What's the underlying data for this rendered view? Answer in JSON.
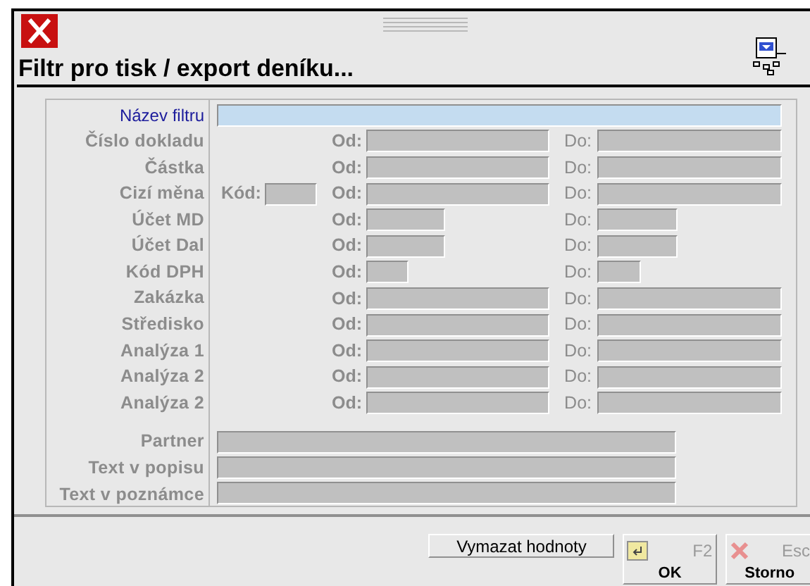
{
  "window": {
    "title": "Filtr pro tisk / export deníku..."
  },
  "name_filter": {
    "label": "Název filtru",
    "focused": true
  },
  "range_rows": [
    {
      "label": "Číslo dokladu",
      "from_label": "Od:",
      "to_label": "Do:",
      "kind": "wide"
    },
    {
      "label": "Částka",
      "from_label": "Od:",
      "to_label": "Do:",
      "kind": "wide"
    },
    {
      "label": "Cizí měna",
      "code_label": "Kód:",
      "from_label": "Od:",
      "to_label": "Do:",
      "kind": "wide"
    },
    {
      "label": "Účet MD",
      "from_label": "Od:",
      "to_label": "Do:",
      "kind": "medium"
    },
    {
      "label": "Účet Dal",
      "from_label": "Od:",
      "to_label": "Do:",
      "kind": "medium"
    },
    {
      "label": "Kód DPH",
      "from_label": "Od:",
      "to_label": "Do:",
      "kind": "narrow"
    },
    {
      "label": "Zakázka",
      "from_label": "Od:",
      "to_label": "Do:",
      "kind": "wide"
    },
    {
      "label": "Středisko",
      "from_label": "Od:",
      "to_label": "Do:",
      "kind": "wide"
    },
    {
      "label": "Analýza 1",
      "from_label": "Od:",
      "to_label": "Do:",
      "kind": "wide"
    },
    {
      "label": "Analýza 2",
      "from_label": "Od:",
      "to_label": "Do:",
      "kind": "wide"
    },
    {
      "label": "Analýza 2",
      "from_label": "Od:",
      "to_label": "Do:",
      "kind": "wide"
    }
  ],
  "text_rows": [
    {
      "label": "Partner"
    },
    {
      "label": "Text v popisu"
    },
    {
      "label": "Text v poznámce"
    }
  ],
  "buttons": {
    "clear": "Vymazat hodnoty",
    "ok": {
      "label": "OK",
      "shortcut": "F2"
    },
    "cancel": {
      "label": "Storno",
      "shortcut": "Esc"
    }
  }
}
